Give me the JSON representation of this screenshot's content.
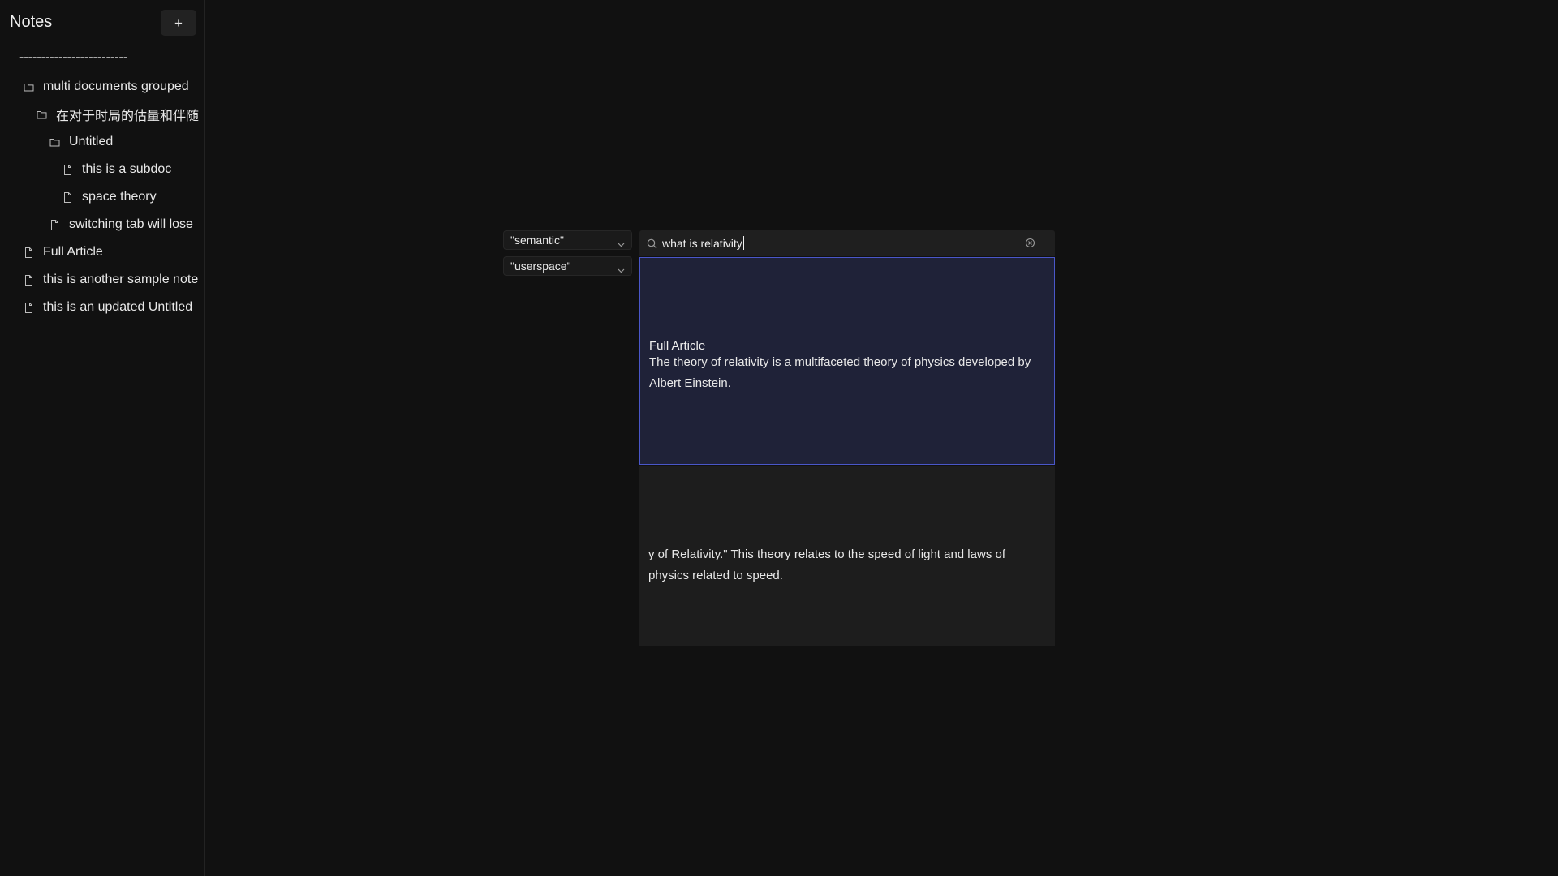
{
  "sidebar": {
    "title": "Notes",
    "add_label": "+",
    "divider": "-------------------------",
    "items": [
      {
        "label": "multi documents grouped",
        "type": "folder"
      },
      {
        "label": "在对于时局的估量和伴随",
        "type": "folder"
      },
      {
        "label": "Untitled",
        "type": "folder"
      },
      {
        "label": "this is a subdoc",
        "type": "document"
      },
      {
        "label": "space theory",
        "type": "document"
      },
      {
        "label": "switching tab will lose",
        "type": "document"
      },
      {
        "label": "Full Article",
        "type": "document"
      },
      {
        "label": "this is another sample note",
        "type": "document"
      },
      {
        "label": "this is an updated Untitled",
        "type": "document"
      }
    ]
  },
  "filters": {
    "mode": {
      "selected": "\"semantic\""
    },
    "scope": {
      "selected": "\"userspace\""
    }
  },
  "search": {
    "query": "what is relativity",
    "icon": "search-icon",
    "clear_icon": "clear-icon"
  },
  "results": [
    {
      "title": "Full Article",
      "snippet": "The theory of relativity is a multifaceted theory of physics developed by Albert Einstein."
    },
    {
      "title": "",
      "snippet": "y of Relativity.\" This theory relates to the speed of light and laws of physics related to speed."
    }
  ],
  "colors": {
    "background": "#111111",
    "panel": "#1f1f1f",
    "selected_result": "#1f2238",
    "selected_border": "#4a57c9"
  }
}
